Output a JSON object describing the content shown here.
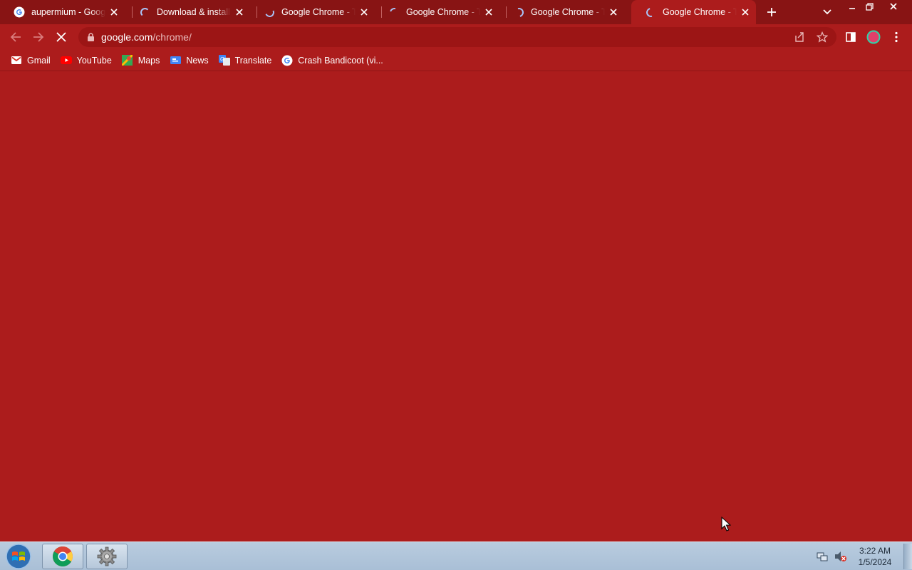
{
  "window": {
    "accent": "#ac1c1c",
    "tabstrip_color": "#881414"
  },
  "tabs": [
    {
      "title": "aupermium - Google",
      "icon": "google-g-icon",
      "loading": false,
      "active": false
    },
    {
      "title": "Download & install Google Chrome",
      "icon": "loading-spinner-icon",
      "loading": true,
      "active": false
    },
    {
      "title": "Google Chrome - The",
      "icon": "loading-spinner-icon",
      "loading": true,
      "active": false
    },
    {
      "title": "Google Chrome - The",
      "icon": "loading-spinner-icon",
      "loading": true,
      "active": false
    },
    {
      "title": "Google Chrome - The",
      "icon": "loading-spinner-icon",
      "loading": true,
      "active": false
    },
    {
      "title": "Google Chrome - The",
      "icon": "loading-spinner-icon",
      "loading": true,
      "active": true
    }
  ],
  "toolbar": {
    "url_host": "google.com",
    "url_path": "/chrome/"
  },
  "bookmarks": [
    {
      "label": "Gmail",
      "icon": "gmail-icon"
    },
    {
      "label": "YouTube",
      "icon": "youtube-icon"
    },
    {
      "label": "Maps",
      "icon": "maps-icon"
    },
    {
      "label": "News",
      "icon": "news-icon"
    },
    {
      "label": "Translate",
      "icon": "translate-icon"
    },
    {
      "label": "Crash Bandicoot (vi...",
      "icon": "google-g-icon"
    }
  ],
  "taskbar": {
    "apps": [
      {
        "name": "Google Chrome",
        "icon": "chrome-icon"
      },
      {
        "name": "Settings",
        "icon": "gear-icon"
      }
    ],
    "clock_time": "3:22 AM",
    "clock_date": "1/5/2024"
  }
}
